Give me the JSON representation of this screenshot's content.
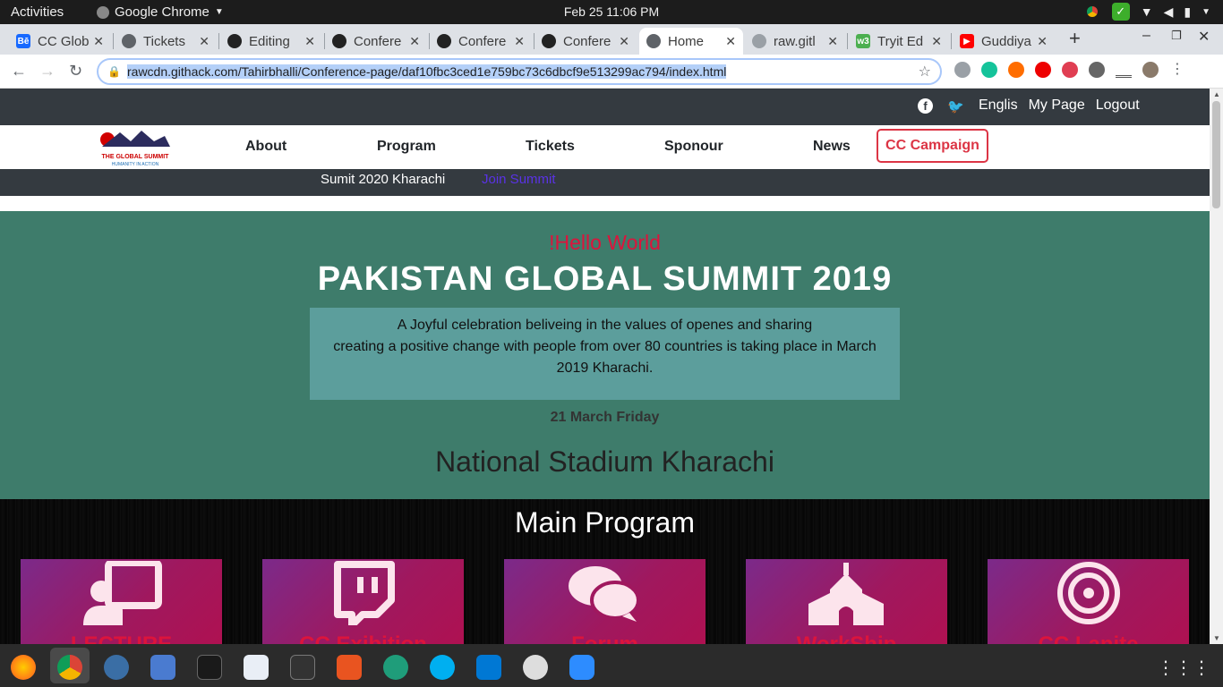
{
  "system": {
    "activities": "Activities",
    "app_name": "Google Chrome",
    "clock": "Feb 25  11:06 PM"
  },
  "tabs": [
    {
      "title": "CC Glob",
      "fav": "behance"
    },
    {
      "title": "Tickets",
      "fav": "globe"
    },
    {
      "title": "Editing",
      "fav": "github"
    },
    {
      "title": "Confere",
      "fav": "github"
    },
    {
      "title": "Confere",
      "fav": "github"
    },
    {
      "title": "Confere",
      "fav": "github"
    },
    {
      "title": "Home",
      "fav": "globe",
      "active": true
    },
    {
      "title": "raw.gitl",
      "fav": "cloud"
    },
    {
      "title": "Tryit Ed",
      "fav": "w3"
    },
    {
      "title": "Guddiya",
      "fav": "youtube"
    }
  ],
  "address": {
    "url": "rawcdn.githack.com/Tahirbhalli/Conference-page/daf10fbc3ced1e759bc73c6dbcf9e513299ac794/index.html"
  },
  "site": {
    "top_links": [
      "Englis",
      "My Page",
      "Logout"
    ],
    "nav": [
      "About",
      "Program",
      "Tickets",
      "Sponour",
      "News"
    ],
    "campaign": "CC Campaign",
    "logo_text": "THE GLOBAL SUMMIT",
    "logo_sub": "HUMANITY IN ACTION",
    "subnav_1": "Sumit 2020 Kharachi",
    "subnav_2": "Join Summit",
    "hero": {
      "hello": "!Hello World",
      "headline": "PAKISTAN GLOBAL SUMMIT 2019",
      "line1": "A Joyful celebration beliveing in the values of openes and sharing",
      "line2": "creating a positive change with people from over 80 countries is taking place in March 2019 Kharachi.",
      "date": "21 March Friday",
      "venue": "National Stadium Kharachi"
    },
    "program_title": "Main Program",
    "cards": [
      {
        "label": "LECTURE",
        "icon": "presentation-icon"
      },
      {
        "label": "CC Exibition",
        "icon": "twitch-icon"
      },
      {
        "label": "Forum",
        "icon": "comments-icon"
      },
      {
        "label": "WorkShip",
        "icon": "church-icon"
      },
      {
        "label": "CC Lanite",
        "icon": "target-icon"
      }
    ]
  },
  "colors": {
    "header_dark": "#343a40",
    "hero_bg": "#3e7c6b",
    "hello_red": "#dc143c",
    "campaign_red": "#dc3545",
    "card_grad_start": "#7b2a8a",
    "card_grad_end": "#b01050"
  }
}
